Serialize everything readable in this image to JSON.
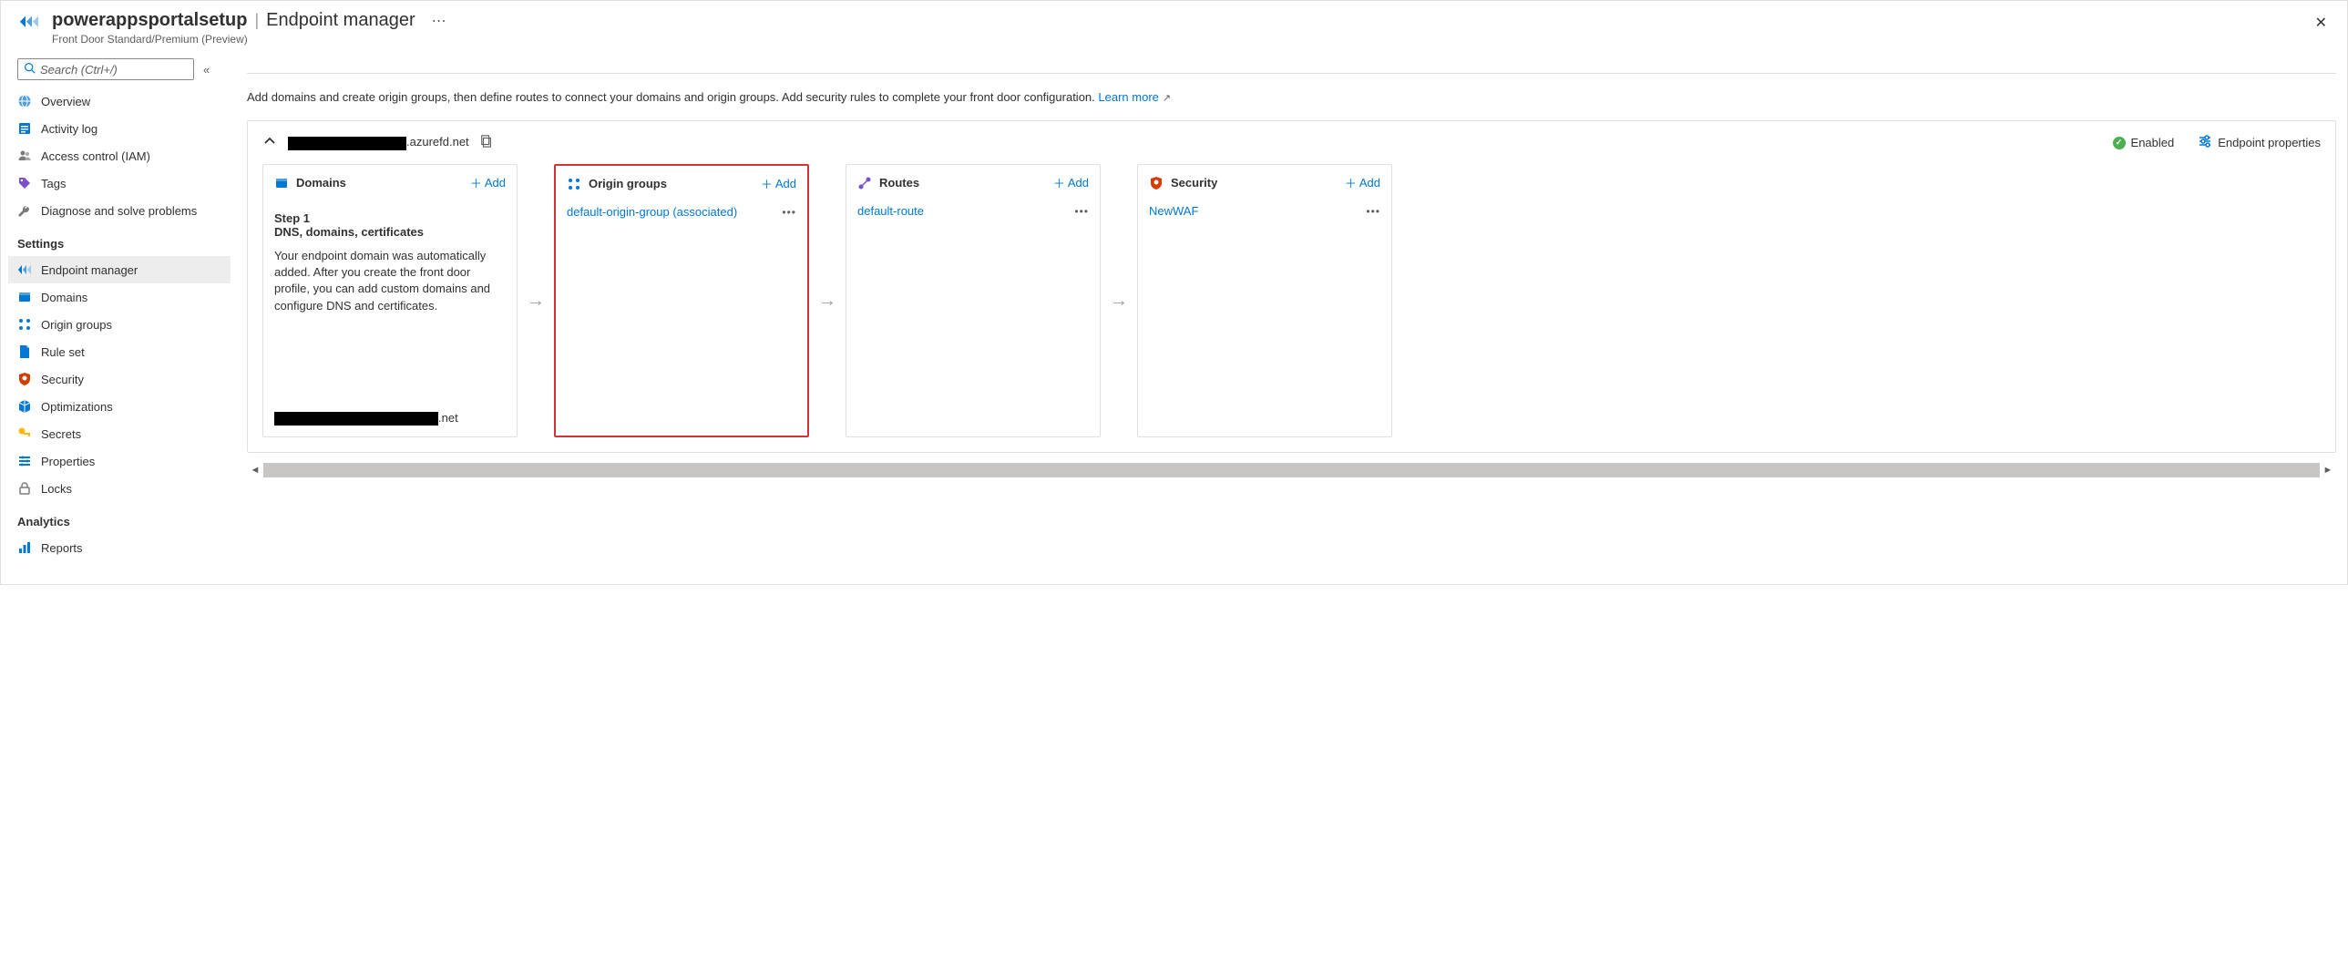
{
  "header": {
    "resource_name": "powerappsportalsetup",
    "page_title": "Endpoint manager",
    "subtitle": "Front Door Standard/Premium (Preview)"
  },
  "search": {
    "placeholder": "Search (Ctrl+/)"
  },
  "nav": {
    "top": [
      {
        "key": "overview",
        "label": "Overview"
      },
      {
        "key": "activity-log",
        "label": "Activity log"
      },
      {
        "key": "access-control",
        "label": "Access control (IAM)"
      },
      {
        "key": "tags",
        "label": "Tags"
      },
      {
        "key": "diagnose",
        "label": "Diagnose and solve problems"
      }
    ],
    "settings_heading": "Settings",
    "settings": [
      {
        "key": "endpoint-manager",
        "label": "Endpoint manager",
        "selected": true
      },
      {
        "key": "domains",
        "label": "Domains"
      },
      {
        "key": "origin-groups",
        "label": "Origin groups"
      },
      {
        "key": "rule-set",
        "label": "Rule set"
      },
      {
        "key": "security",
        "label": "Security"
      },
      {
        "key": "optimizations",
        "label": "Optimizations"
      },
      {
        "key": "secrets",
        "label": "Secrets"
      },
      {
        "key": "properties",
        "label": "Properties"
      },
      {
        "key": "locks",
        "label": "Locks"
      }
    ],
    "analytics_heading": "Analytics",
    "analytics": [
      {
        "key": "reports",
        "label": "Reports"
      }
    ]
  },
  "intro": {
    "text": "Add domains and create origin groups, then define routes to connect your domains and origin groups. Add security rules to complete your front door configuration.",
    "learn_more": "Learn more"
  },
  "endpoint": {
    "host_suffix": ".azurefd.net",
    "enabled_label": "Enabled",
    "properties_label": "Endpoint properties"
  },
  "cards": {
    "add_label": "Add",
    "domains": {
      "title": "Domains",
      "step_label": "Step 1",
      "step_heading": "DNS, domains, certificates",
      "step_desc": "Your endpoint domain was automatically added. After you create the front door profile, you can add custom domains and configure DNS and certificates.",
      "domain_suffix": ".net"
    },
    "origin_groups": {
      "title": "Origin groups",
      "item": "default-origin-group (associated)"
    },
    "routes": {
      "title": "Routes",
      "item": "default-route"
    },
    "security": {
      "title": "Security",
      "item": "NewWAF"
    }
  }
}
